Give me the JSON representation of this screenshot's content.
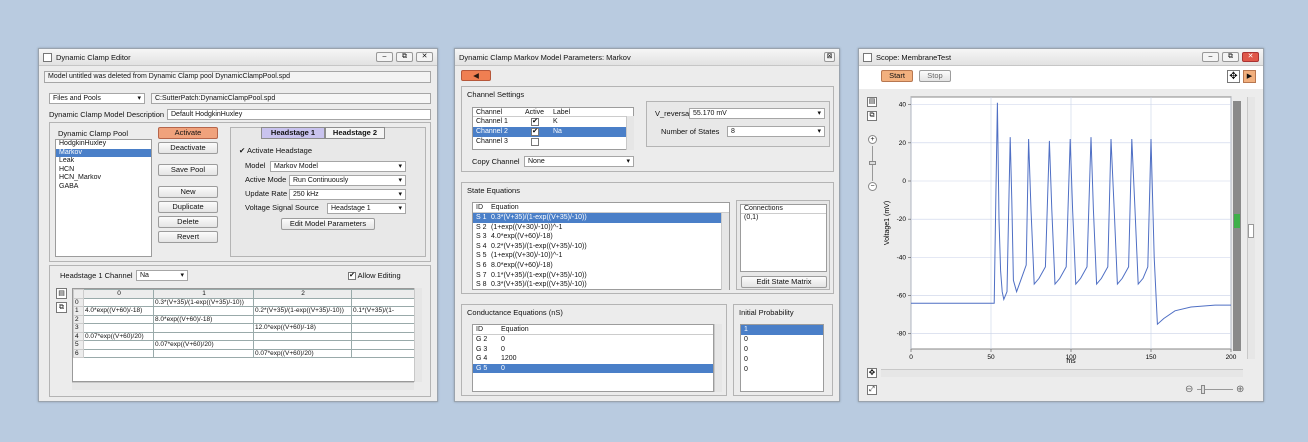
{
  "editor": {
    "title": "Dynamic Clamp Editor",
    "buttons": {
      "minimize": "–",
      "restore": "⧉",
      "close": "✕"
    },
    "message": "Model untitled was deleted from Dynamic Clamp pool DynamicClampPool.spd",
    "files_select": "Files and Pools",
    "path": "C:SutterPatch:DynamicClampPool.spd",
    "desc_label": "Dynamic Clamp Model Description",
    "desc_value": "Default HodgkinHuxley",
    "pool_header": "Dynamic Clamp Pool",
    "pool_items": [
      "HodgkinHuxley",
      "Markov",
      "Leak",
      "HCN",
      "HCN_Markov",
      "GABA"
    ],
    "pool_selected": 1,
    "action_buttons": [
      "Activate",
      "Deactivate",
      "Save Pool",
      "New",
      "Duplicate",
      "Delete",
      "Revert"
    ],
    "tabs": [
      "Headstage 1",
      "Headstage 2"
    ],
    "activate_headstage": "Activate Headstage",
    "model_label": "Model",
    "model_value": "Markov Model",
    "mode_label": "Active Mode",
    "mode_value": "Run Continuously",
    "rate_label": "Update Rate",
    "rate_value": "250 kHz",
    "vsrc_label": "Voltage Signal Source",
    "vsrc_value": "Headstage 1",
    "edit_params": "Edit Model Parameters",
    "hs_channel_label": "Headstage 1 Channel",
    "hs_channel_value": "Na",
    "allow_editing": "Allow Editing",
    "matrix_cols": [
      "0",
      "1",
      "2",
      ""
    ],
    "matrix_rows": [
      [
        "0",
        "",
        "0.3*(V+35)/(1-exp((V+35)/-10))",
        "",
        ""
      ],
      [
        "1",
        "4.0*exp((V+60)/-18)",
        "",
        "0.2*(V+35)/(1-exp((V+35)/-10))",
        "0.1*(V+35)/(1-"
      ],
      [
        "2",
        "",
        "8.0*exp((V+60)/-18)",
        "",
        ""
      ],
      [
        "3",
        "",
        "",
        "12.0*exp((V+60)/-18)",
        ""
      ],
      [
        "4",
        "0.07*exp((V+60)/20)",
        "",
        "",
        ""
      ],
      [
        "5",
        "",
        "0.07*exp((V+60)/20)",
        "",
        ""
      ],
      [
        "6",
        "",
        "",
        "0.07*exp((V+60)/20)",
        ""
      ]
    ]
  },
  "markov": {
    "title": "Dynamic Clamp Markov Model Parameters: Markov",
    "close": "⊠",
    "back": "◀",
    "channel_settings": "Channel Settings",
    "ch_headers": [
      "Channel",
      "Active",
      "Label"
    ],
    "channels": [
      [
        "Channel 1",
        "✔",
        "K"
      ],
      [
        "Channel 2",
        "✔",
        "Na"
      ],
      [
        "Channel 3",
        "",
        ""
      ]
    ],
    "ch_selected": 1,
    "copy_label": "Copy Channel",
    "copy_value": "None",
    "vrev_label": "V_reversal",
    "vrev_value": "55.170 mV",
    "nstates_label": "Number of States",
    "nstates_value": "8",
    "state_eq_title": "State Equations",
    "eq_headers": [
      "ID",
      "Equation"
    ],
    "states": [
      [
        "S 1",
        "0.3*(V+35)/(1-exp((V+35)/-10))"
      ],
      [
        "S 2",
        "(1+exp((V+30)/-10))^-1"
      ],
      [
        "S 3",
        "4.0*exp((V+60)/-18)"
      ],
      [
        "S 4",
        "0.2*(V+35)/(1-exp((V+35)/-10))"
      ],
      [
        "S 5",
        "(1+exp((V+30)/-10))^-1"
      ],
      [
        "S 6",
        "8.0*exp((V+60)/-18)"
      ],
      [
        "S 7",
        "0.1*(V+35)/(1-exp((V+35)/-10))"
      ],
      [
        "S 8",
        "0.3*(V+35)/(1-exp((V+35)/-10))"
      ]
    ],
    "state_selected": 0,
    "connections_header": "Connections",
    "connections_value": "(0,1)",
    "edit_state_matrix": "Edit State Matrix",
    "cond_title": "Conductance Equations (nS)",
    "cond": [
      [
        "G 2",
        "0"
      ],
      [
        "G 3",
        "0"
      ],
      [
        "G 4",
        "1200"
      ],
      [
        "G 5",
        "0"
      ]
    ],
    "cond_selected": 3,
    "init_title": "Initial Probability",
    "init": [
      "1",
      "0",
      "0",
      "0",
      "0"
    ],
    "init_selected": 0
  },
  "scope": {
    "title": "Scope: MembraneTest",
    "start": "Start",
    "stop": "Stop",
    "ylabel": "Voltage1 (mV)",
    "xlabel": "ms",
    "yticks": [
      "40",
      "20",
      "0",
      "-20",
      "-40",
      "-60",
      "-80"
    ],
    "xticks": [
      "0",
      "50",
      "100",
      "150",
      "200"
    ],
    "zoom_out": "⊖",
    "zoom_in": "⊕"
  },
  "chart_data": {
    "type": "line",
    "xlabel": "ms",
    "ylabel": "Voltage1 (mV)",
    "xlim": [
      0,
      200
    ],
    "ylim": [
      -88,
      44
    ],
    "grid": true,
    "spike_times": [
      54,
      62,
      73.5,
      86.5,
      99.5,
      112.5,
      125,
      138,
      150
    ],
    "spike_peaks": [
      41,
      23,
      22,
      21,
      22,
      23,
      22,
      22,
      22
    ],
    "series": [
      {
        "x": [
          0,
          52,
          53,
          54,
          55,
          56,
          57,
          58,
          60,
          62,
          63,
          64,
          66,
          69,
          72,
          73.5,
          75,
          77,
          80,
          84,
          86.5,
          88,
          90,
          93,
          97,
          99.5,
          101,
          103,
          106,
          110,
          112.5,
          114,
          116,
          119,
          123,
          125,
          127,
          129,
          132,
          136,
          138,
          140,
          142,
          145,
          148,
          150,
          152,
          154,
          158,
          165,
          175,
          190,
          200
        ],
        "y": [
          -64,
          -64,
          -10,
          41,
          -20,
          -47,
          -58,
          -62,
          -58,
          23,
          -10,
          -52,
          -58,
          -51,
          -44,
          22,
          -15,
          -54,
          -51,
          -45,
          21,
          -15,
          -54,
          -51,
          -45,
          22,
          -15,
          -54,
          -51,
          -45,
          23,
          -15,
          -54,
          -51,
          -45,
          22,
          -15,
          -54,
          -51,
          -45,
          22,
          -15,
          -54,
          -51,
          -45,
          22,
          -40,
          -75,
          -72,
          -68,
          -66,
          -65,
          -65
        ]
      }
    ]
  }
}
